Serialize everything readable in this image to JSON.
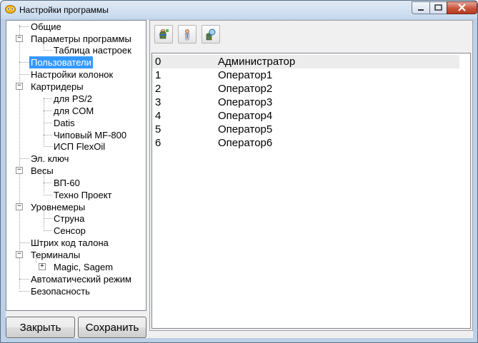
{
  "window": {
    "title": "Настройки программы"
  },
  "tree": {
    "items": [
      {
        "label": "Общие"
      },
      {
        "label": "Параметры программы"
      },
      {
        "label": "Таблица настроек"
      },
      {
        "label": "Пользователи"
      },
      {
        "label": "Настройки колонок"
      },
      {
        "label": "Картридеры"
      },
      {
        "label": "для PS/2"
      },
      {
        "label": "для COM"
      },
      {
        "label": "Datis"
      },
      {
        "label": "Чиповый MF-800"
      },
      {
        "label": "ИСП FlexOil"
      },
      {
        "label": "Эл. ключ"
      },
      {
        "label": "Весы"
      },
      {
        "label": "ВП-60"
      },
      {
        "label": "Техно Проект"
      },
      {
        "label": "Уровнемеры"
      },
      {
        "label": "Струна"
      },
      {
        "label": "Сенсор"
      },
      {
        "label": "Штрих код талона"
      },
      {
        "label": "Терминалы"
      },
      {
        "label": "Magic, Sagem"
      },
      {
        "label": "Автоматический режим"
      },
      {
        "label": "Безопасность"
      }
    ],
    "selected": "Пользователи",
    "expander_expanded": "−",
    "expander_collapsed": "+"
  },
  "buttons": {
    "close_label": "Закрыть",
    "save_label": "Сохранить"
  },
  "toolbar": {
    "icons": [
      "add-user-icon",
      "edit-user-icon",
      "find-user-icon"
    ]
  },
  "users": {
    "rows": [
      {
        "id": "0",
        "name": "Администратор"
      },
      {
        "id": "1",
        "name": "Оператор1"
      },
      {
        "id": "2",
        "name": "Оператор2"
      },
      {
        "id": "3",
        "name": "Оператор3"
      },
      {
        "id": "4",
        "name": "Оператор4"
      },
      {
        "id": "5",
        "name": "Оператор5"
      },
      {
        "id": "6",
        "name": "Оператор6"
      }
    ]
  },
  "colors": {
    "selection": "#3399ff",
    "titlebar": "#c9daee",
    "close_button": "#c9543c"
  }
}
